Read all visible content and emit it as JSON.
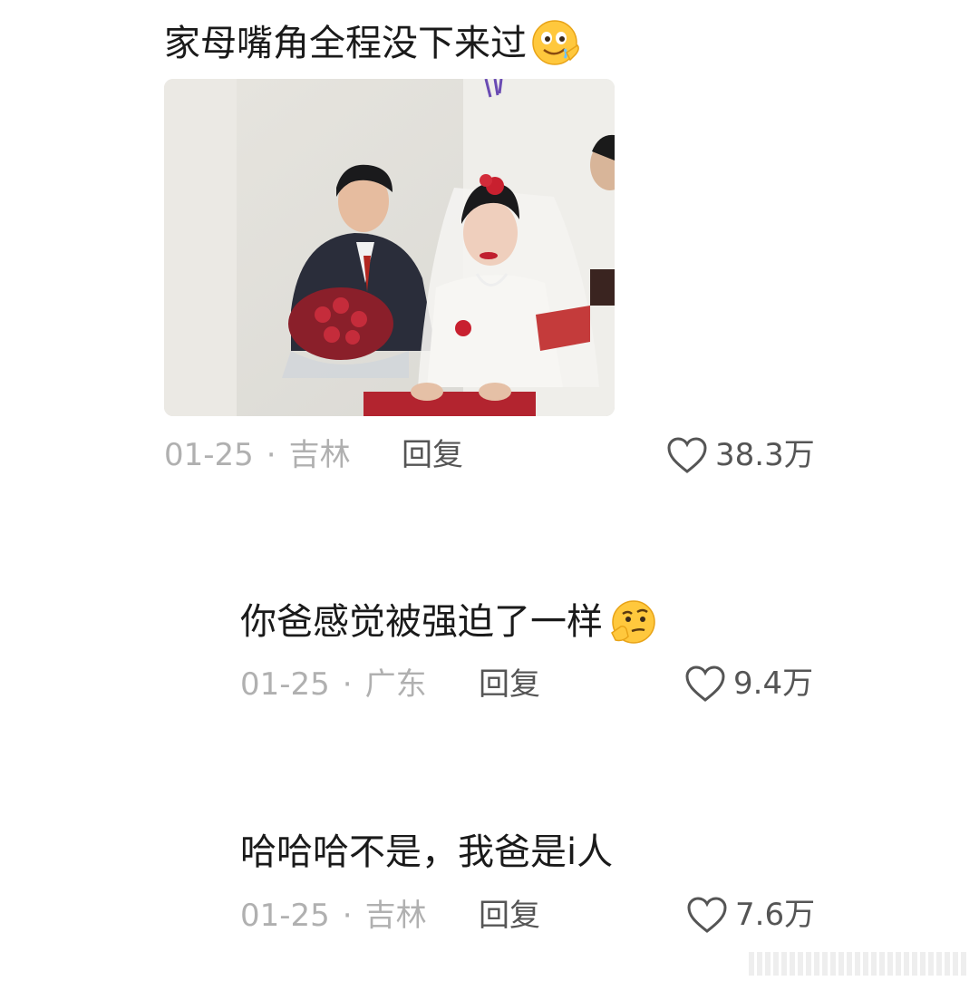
{
  "comments": [
    {
      "text": "家母嘴角全程没下来过",
      "emoji": "drooling-face-emoji",
      "date": "01-25",
      "separator": "·",
      "location": "吉林",
      "reply_label": "回复",
      "likes": "38.3万",
      "has_photo": true
    },
    {
      "text": "你爸感觉被强迫了一样",
      "emoji": "thinking-face-emoji",
      "date": "01-25",
      "separator": "·",
      "location": "广东",
      "reply_label": "回复",
      "likes": "9.4万"
    },
    {
      "text": "哈哈哈不是，我爸是i人",
      "date": "01-25",
      "separator": "·",
      "location": "吉林",
      "reply_label": "回复",
      "likes": "7.6万"
    }
  ],
  "icons": {
    "like": "heart-outline-icon"
  },
  "colors": {
    "text_primary": "#1a1a1a",
    "text_meta": "#b0b0b0",
    "text_action": "#555555"
  }
}
